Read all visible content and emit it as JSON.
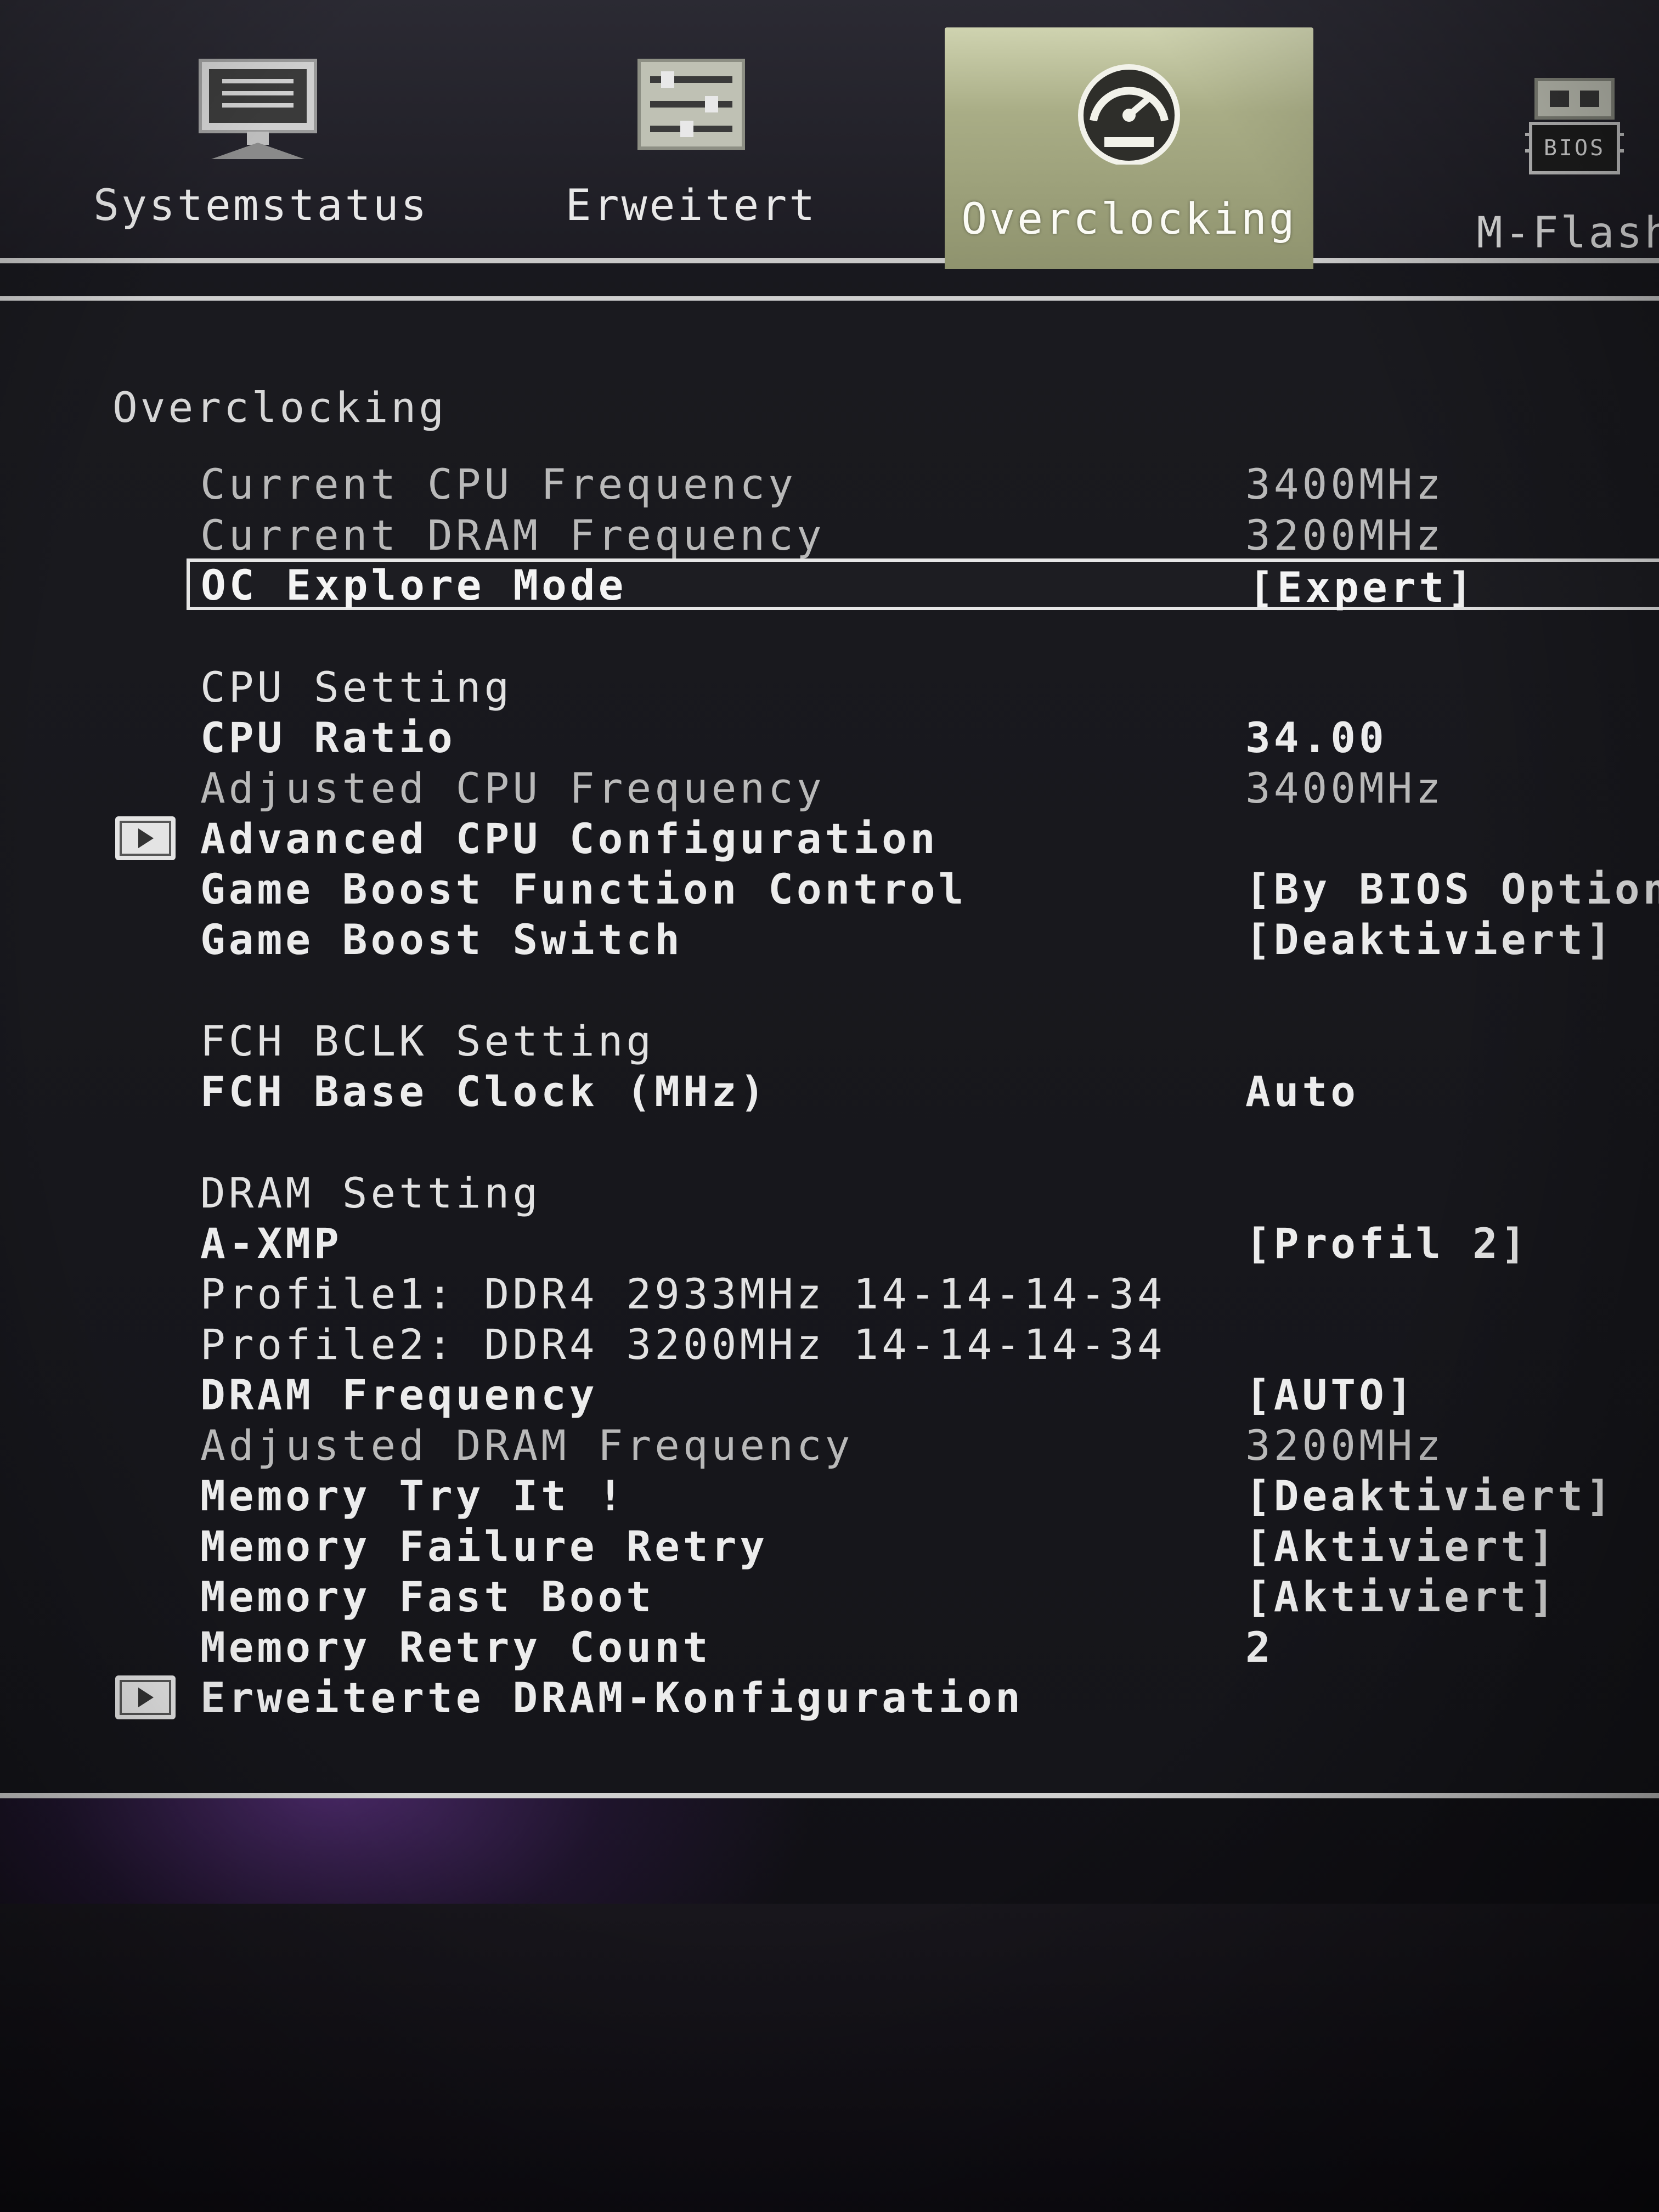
{
  "tabs": {
    "system": {
      "label": "Systemstatus",
      "icon": "monitor-icon"
    },
    "advanced": {
      "label": "Erweitert",
      "icon": "sliders-icon"
    },
    "overclocking": {
      "label": "Overclocking",
      "icon": "speedometer-icon",
      "active": true
    },
    "mflash": {
      "label": "M-Flash",
      "icon": "bios-chip-icon",
      "chip_text": "BIOS"
    }
  },
  "section": {
    "title": "Overclocking"
  },
  "rows": [
    {
      "label": "Current CPU Frequency",
      "value": "3400MHz"
    },
    {
      "label": "Current DRAM Frequency",
      "value": "3200MHz"
    },
    {
      "label": "OC Explore Mode",
      "value": "[Expert]"
    },
    {
      "label": "CPU Setting",
      "value": ""
    },
    {
      "label": "CPU Ratio",
      "value": "34.00"
    },
    {
      "label": "Adjusted CPU Frequency",
      "value": "3400MHz"
    },
    {
      "label": "Advanced CPU Configuration",
      "value": ""
    },
    {
      "label": "Game Boost Function Control",
      "value": "[By BIOS Options]"
    },
    {
      "label": "Game Boost Switch",
      "value": "[Deaktiviert]"
    },
    {
      "label": "FCH BCLK Setting",
      "value": ""
    },
    {
      "label": "FCH Base Clock (MHz)",
      "value": "Auto"
    },
    {
      "label": "DRAM Setting",
      "value": ""
    },
    {
      "label": "A-XMP",
      "value": "[Profil 2]"
    },
    {
      "label": "Profile1: DDR4 2933MHz 14-14-14-34",
      "value": ""
    },
    {
      "label": "Profile2: DDR4 3200MHz 14-14-14-34",
      "value": ""
    },
    {
      "label": "DRAM Frequency",
      "value": "[AUTO]"
    },
    {
      "label": "Adjusted DRAM Frequency",
      "value": "3200MHz"
    },
    {
      "label": "Memory Try It !",
      "value": "[Deaktiviert]"
    },
    {
      "label": "Memory Failure Retry",
      "value": "[Aktiviert]"
    },
    {
      "label": "Memory Fast Boot",
      "value": "[Aktiviert]"
    },
    {
      "label": "Memory Retry Count",
      "value": "2"
    },
    {
      "label": "Erweiterte DRAM-Konfiguration",
      "value": ""
    }
  ]
}
